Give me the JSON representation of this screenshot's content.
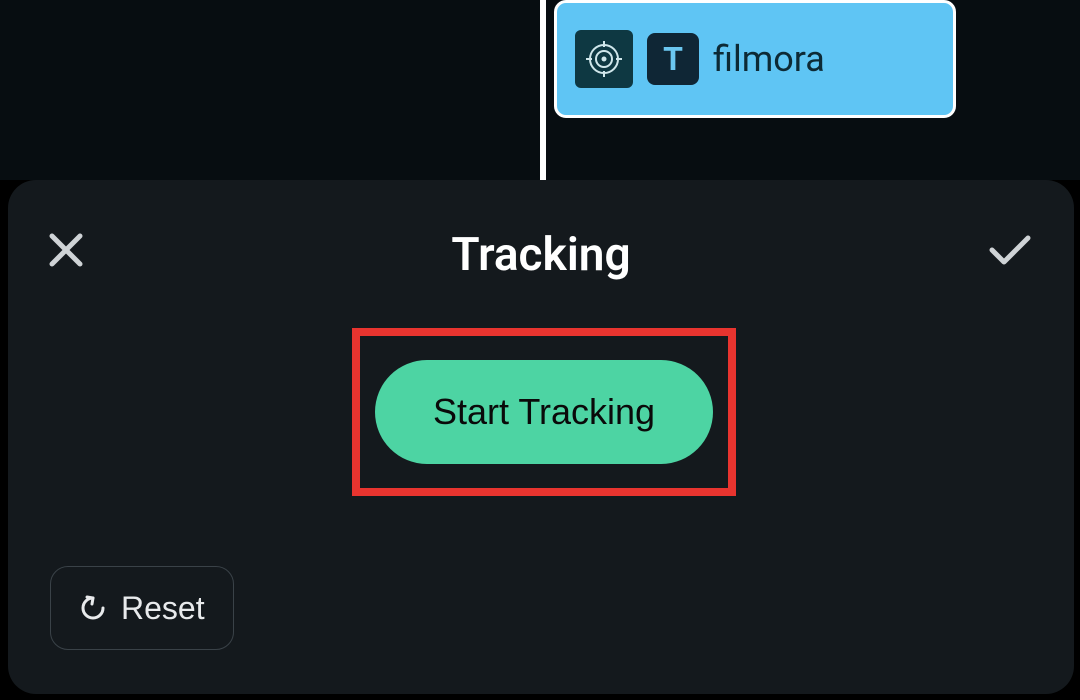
{
  "timeline": {
    "clip_label": "filmora"
  },
  "panel": {
    "title": "Tracking",
    "start_button_label": "Start Tracking",
    "reset_label": "Reset"
  }
}
